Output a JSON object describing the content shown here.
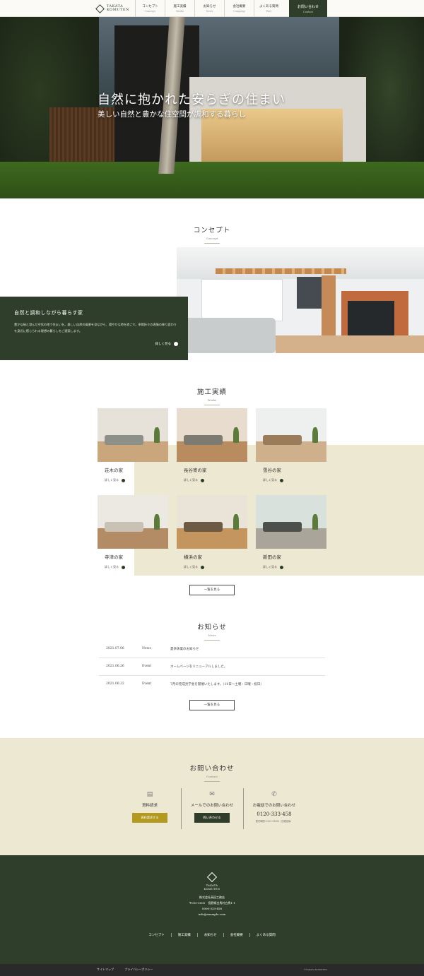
{
  "header": {
    "logo_line1": "TAKATA",
    "logo_line2": "KOMUTEN",
    "nav": [
      {
        "label": "コンセプト",
        "sub": "Concept"
      },
      {
        "label": "施工実績",
        "sub": "Works"
      },
      {
        "label": "お知らせ",
        "sub": "News"
      },
      {
        "label": "会社概要",
        "sub": "Company"
      },
      {
        "label": "よくある質問",
        "sub": "FAQ"
      }
    ],
    "cta": {
      "label": "お問い合わせ",
      "sub": "Contact"
    }
  },
  "hero": {
    "title": "自然に抱かれた安らぎの住まい",
    "subtitle": "美しい自然と豊かな住空間が調和する暮らし"
  },
  "concept": {
    "heading": "コンセプト",
    "heading_en": "Concept",
    "box_title": "自然と調和しながら暮らす家",
    "box_text": "豊かな緑と澄んだ空気の地で住まいを。美しい自然の風景を見ながら、穏やかな時を過ごす。季節折々の表情の移り変わりを身近に感じられる理想の暮らしをご提案します。",
    "more": "詳しく見る"
  },
  "works": {
    "heading": "施工実績",
    "heading_en": "Works",
    "items": [
      {
        "name": "荘木の家",
        "more": "詳しく見る"
      },
      {
        "name": "長谷寄の家",
        "more": "詳しく見る"
      },
      {
        "name": "雪谷の家",
        "more": "詳しく見る"
      },
      {
        "name": "寺津の家",
        "more": "詳しく見る"
      },
      {
        "name": "横浜の家",
        "more": "詳しく見る"
      },
      {
        "name": "新田の家",
        "more": "詳しく見る"
      }
    ],
    "list_button": "一覧を見る"
  },
  "news": {
    "heading": "お知らせ",
    "heading_en": "News",
    "items": [
      {
        "date": "2021.07.06",
        "category": "News",
        "title": "夏季休業のお知らせ"
      },
      {
        "date": "2021.06.26",
        "category": "Event",
        "title": "ホームページをリニューアルしました。"
      },
      {
        "date": "2021.06.22",
        "category": "Event",
        "title": "7月の完成見学会を開催いたします。（10日〜土曜・日曜・祝日）"
      }
    ],
    "list_button": "一覧を見る"
  },
  "contact": {
    "heading": "お問い合わせ",
    "heading_en": "Contact",
    "document": {
      "icon": "document-icon",
      "label": "資料請求",
      "button": "資料請求する"
    },
    "mail": {
      "icon": "mail-icon",
      "label": "メールでのお問い合わせ",
      "button": "問い合わせる"
    },
    "phone": {
      "icon": "phone-icon",
      "label": "お電話でのお問い合わせ",
      "number": "0120-333-458",
      "hours": "受付時間 9:00〜18:00（日曜定休）"
    }
  },
  "footer": {
    "logo_line1": "TAKATA",
    "logo_line2": "KOMUTEN",
    "company": "株式会社高田工務店",
    "address": "〒000-0000　長野県白馬村白馬1-1",
    "tel": "0000-333-458",
    "email": "info@example.com",
    "nav": [
      "コンセプト",
      "施工実績",
      "お知らせ",
      "会社概要",
      "よくある質問"
    ],
    "bottom_links": [
      "サイトマップ",
      "プライバシーポリシー"
    ],
    "copyright": "©TAKATA KOMUTEN"
  },
  "colors": {
    "brand_green": "#2f3e2a",
    "accent_gold": "#b39a1e",
    "beige": "#ede8d2"
  }
}
